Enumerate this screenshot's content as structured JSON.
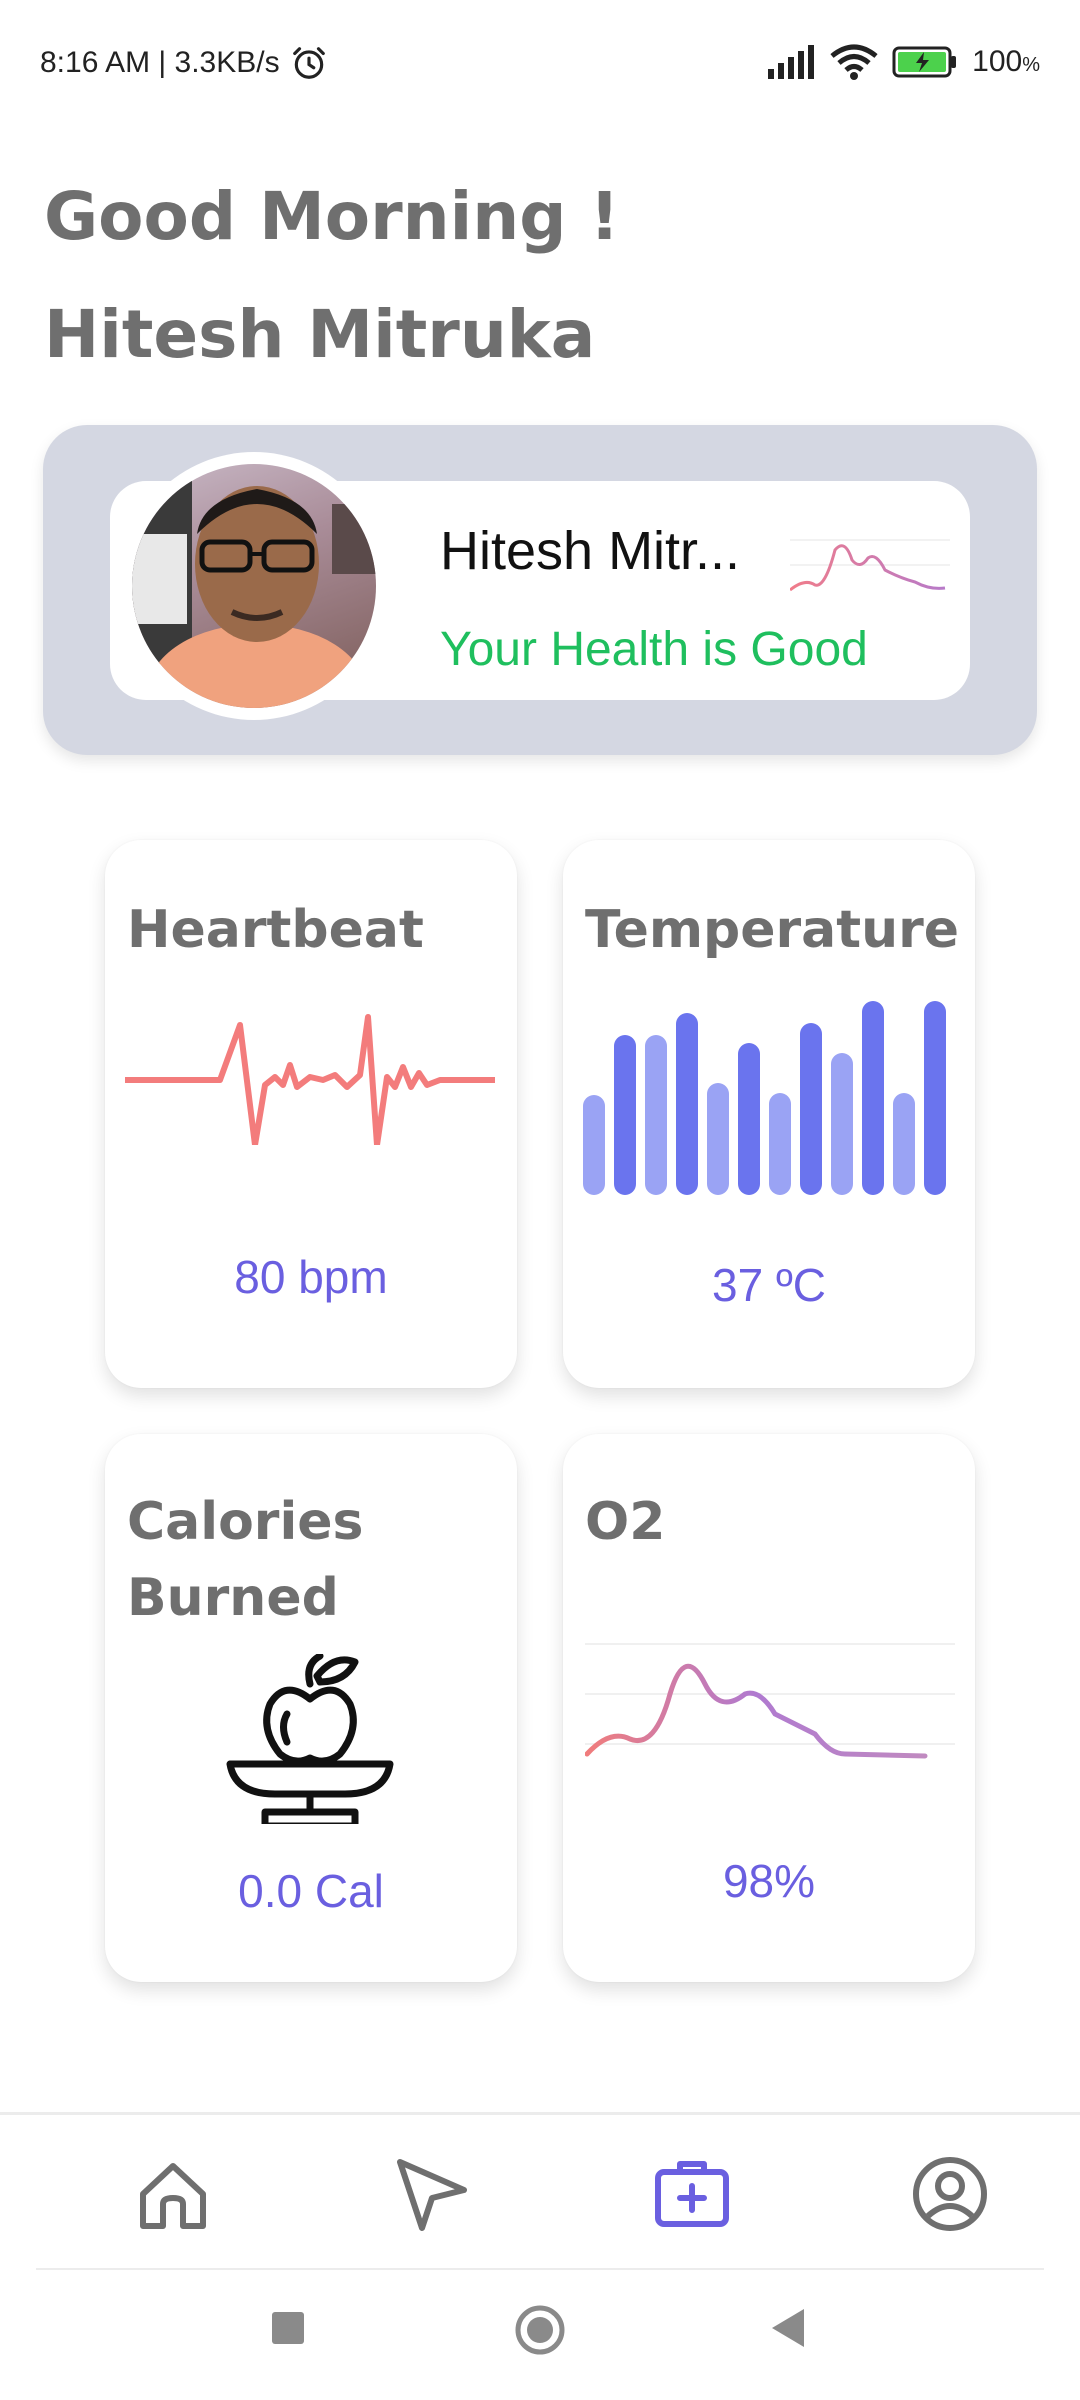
{
  "status_bar": {
    "time_speed": "8:16 AM | 3.3KB/s",
    "battery": "100",
    "battery_unit": "%"
  },
  "greeting": "Good Morning !",
  "user_name": "Hitesh Mitruka",
  "profile_card": {
    "name": "Hitesh Mitr...",
    "health_status": "Your Health is Good",
    "status_color": "#1fbf5e"
  },
  "tiles": {
    "heartbeat": {
      "title": "Heartbeat",
      "value": "80 bpm"
    },
    "temperature": {
      "title": "Temperature",
      "value": "37 ºC"
    },
    "calories": {
      "title_line1": "Calories",
      "title_line2": "Burned",
      "value": "0.0 Cal"
    },
    "o2": {
      "title": "O2",
      "value": "98%"
    }
  },
  "bottom_nav": {
    "items": [
      "home-icon",
      "send-icon",
      "medical-kit-icon",
      "account-icon"
    ],
    "active": "medical-kit-icon",
    "active_color": "#6a5fe0"
  },
  "colors": {
    "heartbeat_line": "#f37c7c",
    "bar_dark": "#6a74ee",
    "bar_light": "#9aa3f4",
    "value_text": "#6a5fe0"
  }
}
